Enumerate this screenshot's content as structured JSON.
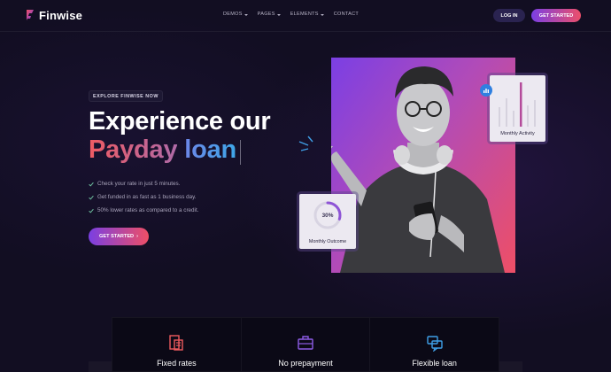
{
  "brand": {
    "name": "Finwise"
  },
  "nav": {
    "items": [
      {
        "label": "DEMOS",
        "has_dropdown": true
      },
      {
        "label": "PAGES",
        "has_dropdown": true
      },
      {
        "label": "ELEMENTS",
        "has_dropdown": true
      },
      {
        "label": "CONTACT",
        "has_dropdown": false
      }
    ],
    "login_label": "LOG IN",
    "get_started_label": "GET STARTED"
  },
  "hero": {
    "tag": "EXPLORE FINWISE NOW",
    "title_line1": "Experience our",
    "title_word1": "Payday",
    "title_word2": "loan",
    "checks": [
      "Check your rate in just 5 minutes.",
      "Get funded in as fast as 1 business day.",
      "50% lower rates as compared to a credit."
    ],
    "cta_label": "GET STARTED",
    "cta_arrow": "›"
  },
  "cards": {
    "activity_label": "Monthly Activity",
    "outcome_label": "Monthly Outcome",
    "outcome_value": "30%",
    "outcome_fraction": 0.3
  },
  "features": [
    {
      "label": "Fixed rates",
      "icon": "calculator-document-icon"
    },
    {
      "label": "No prepayment",
      "icon": "briefcase-icon"
    },
    {
      "label": "Flexible loan",
      "icon": "chat-bubbles-icon"
    }
  ],
  "colors": {
    "accent_purple": "#7b3fe4",
    "accent_pink": "#ee4f66",
    "background": "#120e22",
    "check_green": "#6fc1a0"
  }
}
